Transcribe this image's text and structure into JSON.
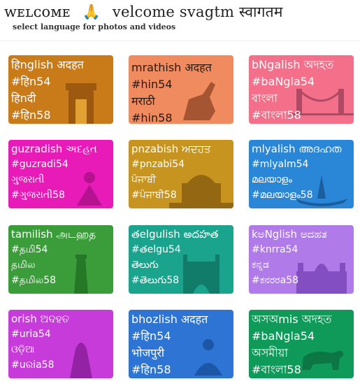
{
  "header": {
    "title_left": "ᴡᴇʟᴄᴏᴍᴇ",
    "pray": "🙏",
    "title_right": "velcome svagtm स्वागतम",
    "subtitle": "select language for photos and videos"
  },
  "colors": {
    "brown": "#c97b1a",
    "orange_peach": "#f08a5f",
    "pink": "#f36f8a",
    "magenta": "#e81bb8",
    "olive": "#c7941f",
    "blue": "#2a86d6",
    "green": "#3a9d3a",
    "teal": "#1aa48e",
    "purple": "#b07be8",
    "violet": "#c63bd9",
    "blue2": "#2d74d4",
    "emerald": "#0f9a5a"
  },
  "cards": [
    {
      "l1": "हिnglish अदहत",
      "l2": "#हिn54",
      "l3": "हिnदी",
      "l4": "#हिn58"
    },
    {
      "l1": "mrathish अदहत",
      "l2": "#hin54",
      "l3": "मराठी",
      "l4": "#hin58"
    },
    {
      "l1": "bNgalish অদহত",
      "l2": "#baNgla54",
      "l3": "বাংলা",
      "l4": "#বাংলা58"
    },
    {
      "l1": "guzradish અદહત",
      "l2": "#guzradi54",
      "l3": "ગુજરાતી",
      "l4": "#ગુજરાતી58"
    },
    {
      "l1": "pnzabish ਅਦਹਤ",
      "l2": "#pnzabi54",
      "l3": "ਪੰਜਾਬੀ",
      "l4": "#ਪੰਜਾਬੀ58"
    },
    {
      "l1": "mlyalish അദഹത",
      "l2": "#mlyalm54",
      "l3": "മലയാളം",
      "l4": "#മലയാളം58"
    },
    {
      "l1": "tamilish அடஹத",
      "l2": "#தமி54",
      "l3": "தமில",
      "l4": "#தமில58"
    },
    {
      "l1": "తelgulish అదహత",
      "l2": "#తelgu54",
      "l3": "తెలుగు",
      "l4": "#తెలుగు58"
    },
    {
      "l1": "kಅNglish ಅದಹತ",
      "l2": "#knrra54",
      "l3": "ಕನ್ನಡ",
      "l4": "#ಕನರರa58"
    },
    {
      "l1": "orish ଅଦହତ",
      "l2": "#uria54",
      "l3": "ଓଡ଼ିଆ",
      "l4": "#uରia58"
    },
    {
      "l1": "bhozlish अदहत",
      "l2": "#हिn54",
      "l3": "भोजपुरी",
      "l4": "#हिn58"
    },
    {
      "l1": "অসঅmis অদহত",
      "l2": "#baNgla54",
      "l3": "অসমীয়া",
      "l4": "#বাংলা58"
    }
  ]
}
